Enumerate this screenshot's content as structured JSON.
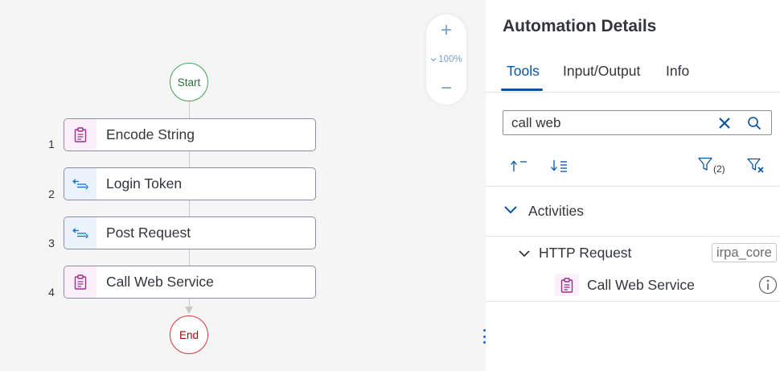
{
  "canvas": {
    "start_label": "Start",
    "end_label": "End",
    "zoom": {
      "in_symbol": "+",
      "out_symbol": "−",
      "level": "100%"
    },
    "steps": [
      {
        "number": "1",
        "label": "Encode String",
        "icon": "clipboard-icon",
        "icon_color": "#9b2d8a"
      },
      {
        "number": "2",
        "label": "Login Token",
        "icon": "flow-list-icon",
        "icon_color": "#0a6ed1"
      },
      {
        "number": "3",
        "label": "Post Request",
        "icon": "flow-list-icon",
        "icon_color": "#0a6ed1"
      },
      {
        "number": "4",
        "label": "Call Web Service",
        "icon": "clipboard-icon",
        "icon_color": "#9b2d8a"
      }
    ]
  },
  "panel": {
    "title": "Automation Details",
    "tabs": [
      {
        "label": "Tools",
        "active": true
      },
      {
        "label": "Input/Output",
        "active": false
      },
      {
        "label": "Info",
        "active": false
      }
    ],
    "search": {
      "value": "call web",
      "placeholder": ""
    },
    "toolbar": {
      "sort_asc_icon": "sort-ascending-icon",
      "sort_desc_icon": "sort-descending-icon",
      "filter_icon": "filter-icon",
      "filter_count": "(2)",
      "clear_filter_icon": "clear-filter-icon"
    },
    "tree": {
      "group_label": "Activities",
      "subgroup_label": "HTTP Request",
      "subgroup_tag": "irpa_core",
      "item_label": "Call Web Service"
    }
  },
  "colors": {
    "accent": "#0854a0",
    "start_border": "#3aa55d",
    "end_border": "#d2353c"
  }
}
